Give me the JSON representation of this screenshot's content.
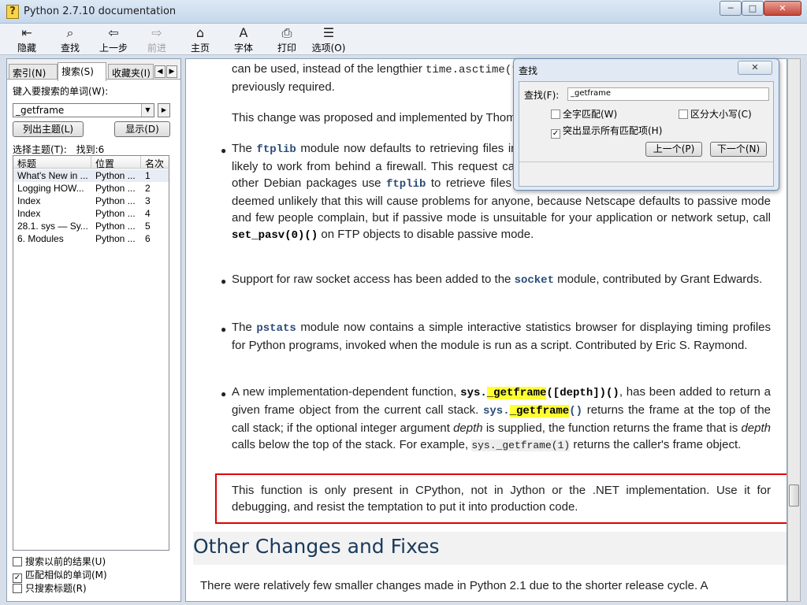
{
  "window": {
    "title": "Python 2.7.10 documentation"
  },
  "window_controls": {
    "minimize": "─",
    "maximize": "□",
    "close": "✕"
  },
  "toolbar": {
    "hide": "隐藏",
    "find": "查找",
    "back": "上一步",
    "forward": "前进",
    "home": "主页",
    "font": "字体",
    "print": "打印",
    "options": "选项(O)"
  },
  "icons": {
    "hide": "⇤",
    "find": "⌕",
    "back": "⇦",
    "forward": "⇨",
    "home": "⌂",
    "font": "A",
    "print": "⎙",
    "options": "☰"
  },
  "left": {
    "tabs": [
      "索引(N)",
      "搜索(S)",
      "收藏夹(I)"
    ],
    "keyword_label": "键入要搜索的单词(W):",
    "keyword_value": "_getframe",
    "list_topics": "列出主题(L)",
    "display": "显示(D)",
    "select_topic": "选择主题(T):",
    "found": "找到:6",
    "columns": [
      "标题",
      "位置",
      "名次"
    ],
    "rows": [
      {
        "title": "What's New in ...",
        "location": "Python ...",
        "rank": "1"
      },
      {
        "title": "Logging HOW...",
        "location": "Python ...",
        "rank": "2"
      },
      {
        "title": "Index",
        "location": "Python ...",
        "rank": "3"
      },
      {
        "title": "Index",
        "location": "Python ...",
        "rank": "4"
      },
      {
        "title": "28.1. sys — Sy...",
        "location": "Python ...",
        "rank": "5"
      },
      {
        "title": "6. Modules",
        "location": "Python ...",
        "rank": "6"
      }
    ],
    "opt_prev": "搜索以前的结果(U)",
    "opt_similar": "匹配相似的单词(M)",
    "opt_titles": "只搜索标题(R)"
  },
  "doc": {
    "p1a": "can be used, instead of the lengthier",
    "p1b": "time.asctime(time.localtime())",
    "p1c": "previously required.",
    "p2": "This change was proposed and implemented by Thomas Wouters.",
    "b1a": "The",
    "b1b": "ftplib",
    "b1c": "module now defaults to retrieving files in passive mode, because passive mode is more likely to work from behind a firewall. This request came from the Debian bug tracking system, since other Debian packages use",
    "b1d": "ftplib",
    "b1e": "to retrieve files and then don't work from behind a firewall. It's deemed unlikely that this will cause problems for anyone, because Netscape defaults to passive mode and few people complain, but if passive mode is unsuitable for your application or network setup, call",
    "b1f": "set_pasv(0)()",
    "b1g": "on FTP objects to disable passive mode.",
    "b2a": "Support for raw socket access has been added to the",
    "b2b": "socket",
    "b2c": "module, contributed by Grant Edwards.",
    "b3a": "The",
    "b3b": "pstats",
    "b3c": "module now contains a simple interactive statistics browser for displaying timing profiles for Python programs, invoked when the module is run as a script. Contributed by Eric S. Raymond.",
    "b4a": "A new implementation-dependent function,",
    "b4b": "sys.",
    "b4c": "_getframe",
    "b4d": "([depth])()",
    "b4e": ", has been added to return a given frame object from the current call stack.",
    "b4f": "sys.",
    "b4g": "_getframe",
    "b4h": "()",
    "b4i": "returns the frame at the top of the call stack; if the optional integer argument",
    "b4j": "depth",
    "b4k": "is supplied, the function returns the frame that is",
    "b4l": "depth",
    "b4m": "calls below the top of the stack. For example,",
    "b4n": "sys.",
    "b4o": "_getframe",
    "b4p": "(1)",
    "b4q": "returns the caller's frame object.",
    "note": "This function is only present in CPython, not in Jython or the .NET implementation. Use it for debugging, and resist the temptation to put it into production code.",
    "h2": "Other Changes and Fixes",
    "last": "There were relatively few smaller changes made in Python 2.1 due to the shorter release cycle. A"
  },
  "find_dialog": {
    "title": "查找",
    "close": "✕",
    "find_label": "查找(F):",
    "find_value": "_getframe",
    "whole_word": "全字匹配(W)",
    "match_case": "区分大小写(C)",
    "highlight_all": "突出显示所有匹配项(H)",
    "prev": "上一个(P)",
    "next": "下一个(N)"
  },
  "colors": {
    "highlight": "#ffff33",
    "red_box": "#e00000",
    "heading": "#1a3a5a"
  }
}
